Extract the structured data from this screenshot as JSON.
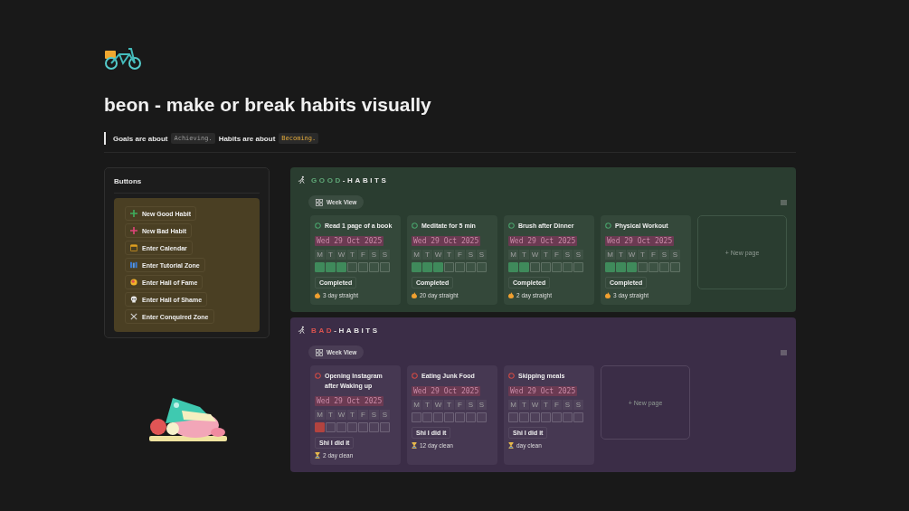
{
  "title": "beon - make or break habits visually",
  "quote": {
    "part_1": "Goals are about",
    "code_1": "Achieving.",
    "part_2": "Habits are about",
    "code_2": "Becoming."
  },
  "buttons_panel": {
    "heading": "Buttons",
    "buttons": [
      {
        "label": "New Good Habit",
        "kind": "plus-green"
      },
      {
        "label": "New Bad Habit",
        "kind": "plus-pink"
      },
      {
        "label": "Enter Calendar",
        "kind": "calendar"
      },
      {
        "label": "Enter Tutorial Zone",
        "kind": "books"
      },
      {
        "label": "Enter Hall of Fame",
        "kind": "medal"
      },
      {
        "label": "Enter Hall of Shame",
        "kind": "skull"
      },
      {
        "label": "Enter Conquired Zone",
        "kind": "swords"
      }
    ]
  },
  "sections": [
    {
      "kind": "good",
      "title_accent": "GOOD",
      "title_rest": "-HABITS",
      "view": "Week View",
      "new_page": "+ New page",
      "cards": [
        {
          "name": "Read 1 page of a book",
          "date": "Wed 29 Oct 2025",
          "days": [
            "M",
            "T",
            "W",
            "T",
            "F",
            "S",
            "S"
          ],
          "checks": [
            {
              "checked": true
            },
            {
              "checked": true
            },
            {
              "checked": true
            },
            {
              "checked": false
            },
            {
              "checked": false
            },
            {
              "checked": false
            },
            {
              "checked": false
            }
          ],
          "status": "Completed",
          "streak": "3 day straight"
        },
        {
          "name": "Meditate for 5 min",
          "date": "Wed 29 Oct 2025",
          "days": [
            "M",
            "T",
            "W",
            "T",
            "F",
            "S",
            "S"
          ],
          "checks": [
            {
              "checked": true
            },
            {
              "checked": true
            },
            {
              "checked": true
            },
            {
              "checked": false
            },
            {
              "checked": false
            },
            {
              "checked": false
            },
            {
              "checked": false
            }
          ],
          "status": "Completed",
          "streak": "20 day straight"
        },
        {
          "name": "Brush after Dinner",
          "date": "Wed 29 Oct 2025",
          "days": [
            "M",
            "T",
            "W",
            "T",
            "F",
            "S",
            "S"
          ],
          "checks": [
            {
              "checked": true
            },
            {
              "checked": true
            },
            {
              "checked": false
            },
            {
              "checked": false
            },
            {
              "checked": false
            },
            {
              "checked": false
            },
            {
              "checked": false
            }
          ],
          "status": "Completed",
          "streak": "2 day straight"
        },
        {
          "name": "Physical Workout",
          "date": "Wed 29 Oct 2025",
          "days": [
            "M",
            "T",
            "W",
            "T",
            "F",
            "S",
            "S"
          ],
          "checks": [
            {
              "checked": true
            },
            {
              "checked": true
            },
            {
              "checked": true
            },
            {
              "checked": false
            },
            {
              "checked": false
            },
            {
              "checked": false
            },
            {
              "checked": false
            }
          ],
          "status": "Completed",
          "streak": "3 day straight"
        }
      ]
    },
    {
      "kind": "bad",
      "title_accent": "BAD",
      "title_rest": "-HABITS",
      "view": "Week View",
      "new_page": "+ New page",
      "cards": [
        {
          "name": "Opening Instagram after Waking up",
          "date": "Wed 29 Oct 2025",
          "days": [
            "M",
            "T",
            "W",
            "T",
            "F",
            "S",
            "S"
          ],
          "checks": [
            {
              "checked": true
            },
            {
              "checked": false
            },
            {
              "checked": false
            },
            {
              "checked": false
            },
            {
              "checked": false
            },
            {
              "checked": false
            },
            {
              "checked": false
            }
          ],
          "status": "Shi I did it",
          "streak": "2 day clean"
        },
        {
          "name": "Eating Junk Food",
          "date": "Wed 29 Oct 2025",
          "days": [
            "M",
            "T",
            "W",
            "T",
            "F",
            "S",
            "S"
          ],
          "checks": [
            {
              "checked": false
            },
            {
              "checked": false
            },
            {
              "checked": false
            },
            {
              "checked": false
            },
            {
              "checked": false
            },
            {
              "checked": false
            },
            {
              "checked": false
            }
          ],
          "status": "Shi I did it",
          "streak": "12 day clean"
        },
        {
          "name": "Skipping meals",
          "date": "Wed 29 Oct 2025",
          "days": [
            "M",
            "T",
            "W",
            "T",
            "F",
            "S",
            "S"
          ],
          "checks": [
            {
              "checked": false
            },
            {
              "checked": false
            },
            {
              "checked": false
            },
            {
              "checked": false
            },
            {
              "checked": false
            },
            {
              "checked": false
            },
            {
              "checked": false
            }
          ],
          "status": "Shi I did it",
          "streak": "day clean"
        }
      ]
    }
  ]
}
